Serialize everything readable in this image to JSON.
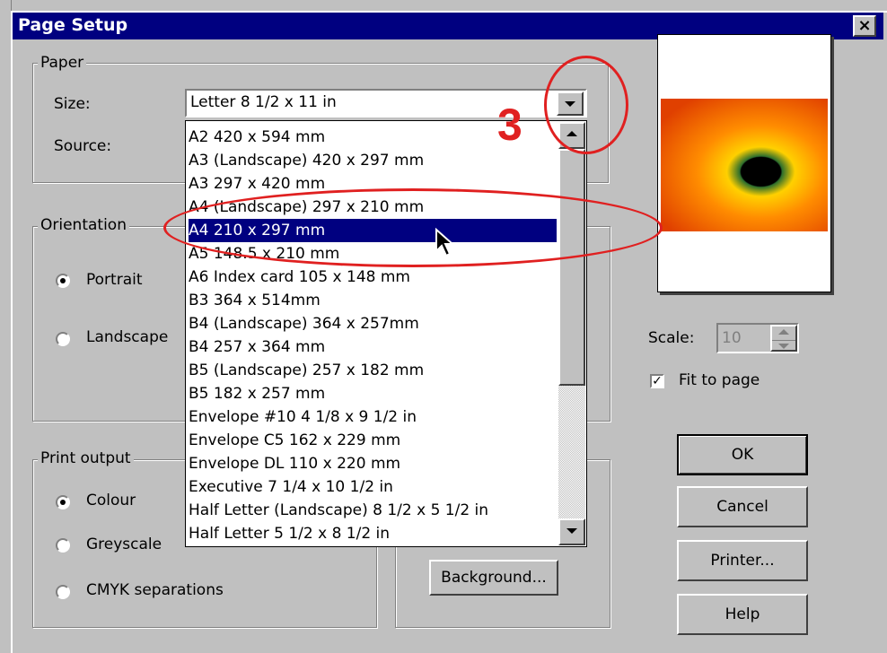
{
  "dialog": {
    "title": "Page Setup",
    "close_label": "×"
  },
  "paper": {
    "legend": "Paper",
    "size_label": "Size:",
    "source_label": "Source:",
    "size_value": "Letter 8 1/2 x 11 in",
    "options": [
      "A2 420 x 594 mm",
      "A3 (Landscape) 420 x 297 mm",
      "A3 297 x 420 mm",
      "A4 (Landscape) 297 x 210 mm",
      "A4 210 x 297 mm",
      "A5 148.5 x 210 mm",
      "A6 Index card 105 x 148 mm",
      "B3 364 x 514mm",
      "B4 (Landscape) 364 x 257mm",
      "B4 257 x 364 mm",
      "B5 (Landscape) 257 x 182 mm",
      "B5 182 x 257 mm",
      "Envelope #10 4 1/8 x 9 1/2 in",
      "Envelope C5 162 x 229 mm",
      "Envelope DL 110 x 220 mm",
      "Executive 7 1/4 x 10 1/2 in",
      "Half Letter (Landscape) 8 1/2 x 5 1/2 in",
      "Half Letter 5 1/2 x 8 1/2 in"
    ],
    "highlighted_option": "A4 210 x 297 mm"
  },
  "orientation": {
    "legend": "Orientation",
    "portrait": "Portrait",
    "landscape": "Landscape",
    "selected": "Portrait"
  },
  "print_output": {
    "legend": "Print output",
    "colour": "Colour",
    "greyscale": "Greyscale",
    "cmyk": "CMYK separations",
    "selected": "Colour"
  },
  "scale": {
    "label": "Scale:",
    "value": "10"
  },
  "fit_to_page": {
    "label": "Fit to page",
    "checked": true,
    "check_mark": "✓"
  },
  "buttons": {
    "ok": "OK",
    "cancel": "Cancel",
    "printer": "Printer...",
    "help": "Help",
    "background": "Background..."
  },
  "annotation": {
    "step_number": "3",
    "color": "#e02020"
  },
  "colors": {
    "title_bar": "#000080",
    "face": "#c0c0c0",
    "highlight": "#000080"
  }
}
